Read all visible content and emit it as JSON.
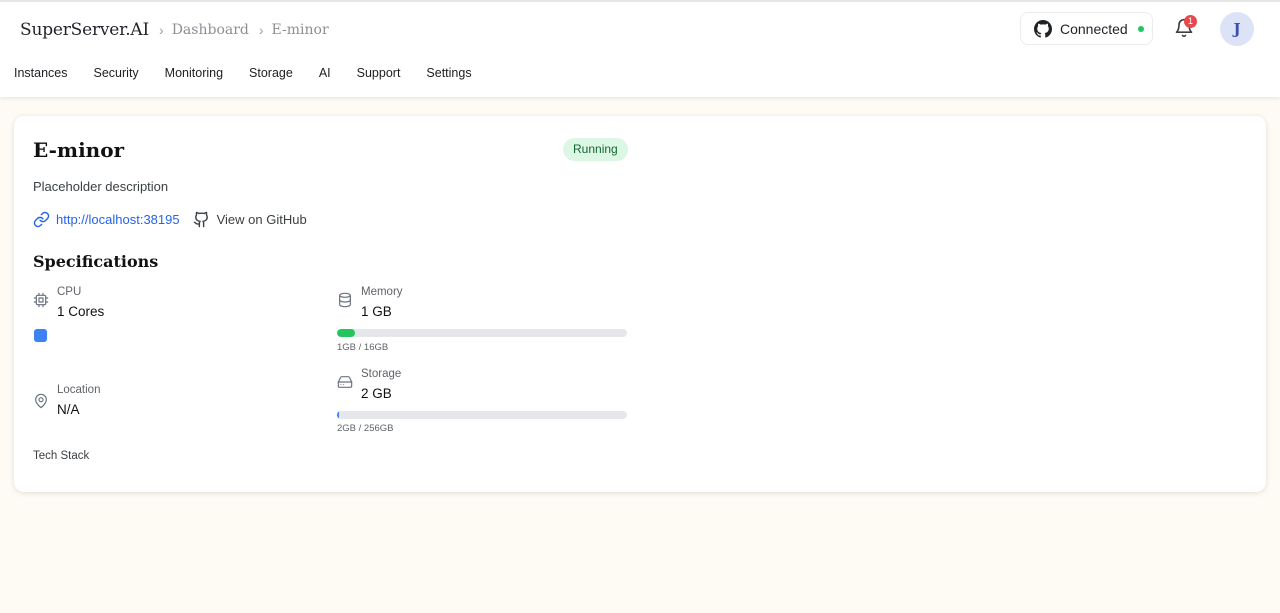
{
  "header": {
    "brand": "SuperServer.AI",
    "breadcrumbs": [
      "Dashboard",
      "E-minor"
    ],
    "nav": [
      "Instances",
      "Security",
      "Monitoring",
      "Storage",
      "AI",
      "Support",
      "Settings"
    ],
    "connection": {
      "label": "Connected",
      "status_color": "#22c55e"
    },
    "notifications": {
      "count": "1"
    },
    "avatar_initial": "J"
  },
  "instance": {
    "name": "E-minor",
    "status": "Running",
    "description": "Placeholder description",
    "url": "http://localhost:38195",
    "github_label": "View on GitHub"
  },
  "specs": {
    "title": "Specifications",
    "cpu": {
      "label": "CPU",
      "value": "1 Cores",
      "color": "#3b82f6"
    },
    "memory": {
      "label": "Memory",
      "value": "1 GB",
      "caption": "1GB / 16GB",
      "fraction": 0.0625,
      "color": "#22c55e"
    },
    "location": {
      "label": "Location",
      "value": "N/A"
    },
    "storage": {
      "label": "Storage",
      "value": "2 GB",
      "caption": "2GB / 256GB",
      "fraction": 0.0078,
      "color": "#3b82f6"
    },
    "tech_stack_label": "Tech Stack"
  }
}
